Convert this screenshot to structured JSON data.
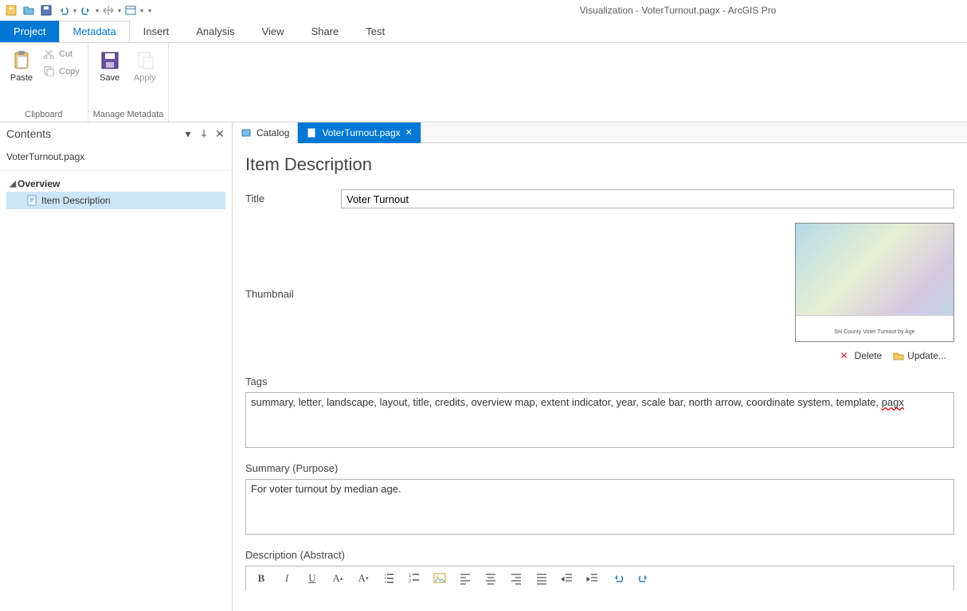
{
  "window": {
    "title_suffix": "Visualization - VoterTurnout.pagx - ArcGIS Pro"
  },
  "qat_icons": [
    "new-project-icon",
    "open-project-icon",
    "save-project-icon",
    "undo-icon",
    "redo-icon",
    "pan-icon",
    "explore-icon"
  ],
  "ribbon": {
    "tabs": [
      "Project",
      "Metadata",
      "Insert",
      "Analysis",
      "View",
      "Share",
      "Test"
    ],
    "active_tab_index": 1,
    "groups": {
      "clipboard": {
        "label": "Clipboard",
        "paste": "Paste",
        "cut": "Cut",
        "copy": "Copy"
      },
      "manage": {
        "label": "Manage Metadata",
        "save": "Save",
        "apply": "Apply"
      }
    }
  },
  "contents": {
    "pane_title": "Contents",
    "filename": "VoterTurnout.pagx",
    "overview_label": "Overview",
    "item_description_label": "Item Description"
  },
  "view_tabs": {
    "catalog": "Catalog",
    "file": "VoterTurnout.pagx"
  },
  "form": {
    "page_title": "Item Description",
    "title_label": "Title",
    "title_value": "Voter Turnout",
    "thumbnail_label": "Thumbnail",
    "thumbnail_caption": "SH County Voter Turnout by Age",
    "delete_label": "Delete",
    "update_label": "Update...",
    "tags_label": "Tags",
    "tags_value_main": "summary, letter, landscape, layout, title, credits, overview map, extent indicator, year, scale bar, north arrow, coordinate system, template, ",
    "tags_value_flagged": "pagx",
    "summary_label": "Summary (Purpose)",
    "summary_value": "For voter turnout by median age.",
    "description_label": "Description (Abstract)"
  },
  "rt_toolbar": [
    "bold",
    "italic",
    "underline",
    "font-grow",
    "font-shrink",
    "bullet-list",
    "numbered-list",
    "insert-image",
    "align-left",
    "align-center",
    "align-right",
    "justify",
    "outdent",
    "indent",
    "undo",
    "redo"
  ]
}
